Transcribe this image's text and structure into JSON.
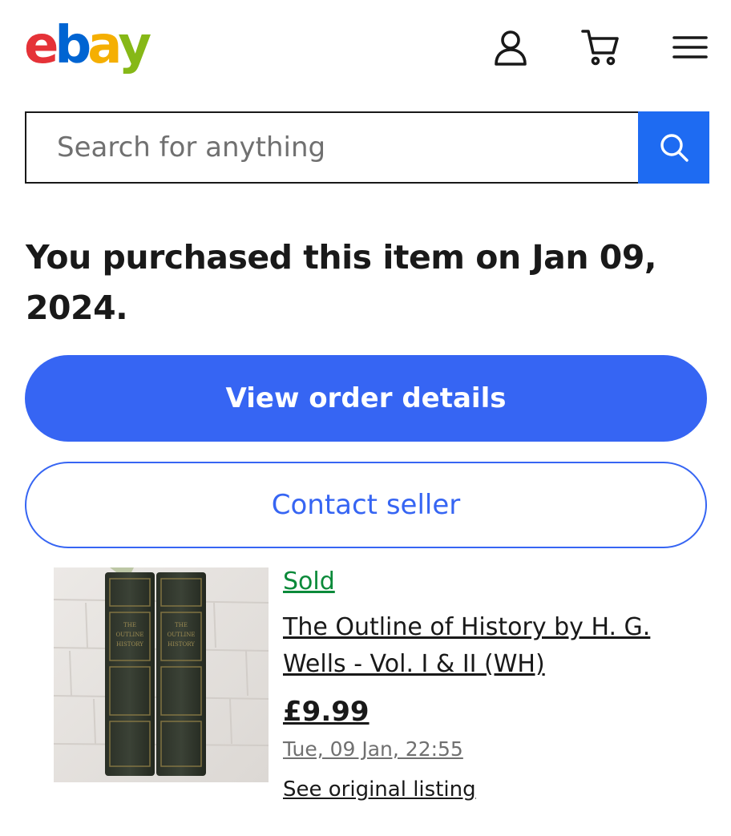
{
  "header": {
    "logo": {
      "letters": [
        "e",
        "b",
        "a",
        "y"
      ],
      "colors": [
        "#e53238",
        "#0064d2",
        "#f5af02",
        "#86b817"
      ]
    },
    "icons": {
      "account": "user-icon",
      "cart": "cart-icon",
      "menu": "hamburger-menu-icon"
    }
  },
  "search": {
    "placeholder": "Search for anything",
    "value": "",
    "button_icon": "search-icon",
    "button_color": "#1e6bf2"
  },
  "purchase": {
    "heading": "You purchased this item on Jan 09, 2024.",
    "primary_button": "View order details",
    "secondary_button": "Contact seller",
    "accent_color": "#3665f3"
  },
  "item": {
    "status": "Sold",
    "status_color": "#0b8a3a",
    "title": "The Outline of History by H. G. Wells - Vol. I & II (WH)",
    "price": "£9.99",
    "date": "Tue, 09 Jan, 22:55",
    "link": "See original listing"
  }
}
